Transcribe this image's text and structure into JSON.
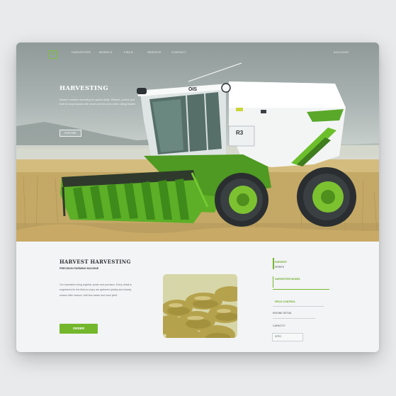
{
  "nav": {
    "logo_glyph": "J",
    "links": [
      "HARVESTER",
      "MODELS",
      "FIELD",
      "SERVICE",
      "CONTACT"
    ],
    "right_link": "ACCOUNT"
  },
  "hero": {
    "title": "HARVESTING",
    "text": "Modern combine harvesting for golden fields. Efficient, precise and built for long seasons with smart controls and a wide cutting header.",
    "button": "EXPLORE",
    "cab_label": "OIS",
    "body_tag": "R3"
  },
  "section": {
    "title": "HARVEST HARVESTING",
    "subtitle": "PRECISION FARMING MACHINE",
    "paragraph": "Our harvesters bring together power and precision. Every detail is engineered for the field so crops are gathered quickly and cleanly, season after season, with less waste and more yield.",
    "cta": "ORDER"
  },
  "sidebar": {
    "label1": "HARVEST",
    "label2": "SERIES",
    "link1": "HARVESTER MODEL",
    "link2": "FIELD CONTROL",
    "item3": "ENGINE DETAIL",
    "item4": "CAPACITY",
    "box_text": "SPEC"
  },
  "colors": {
    "accent": "#74b72d",
    "machine_white": "#f4f6f6",
    "header_green": "#6cbf2a"
  }
}
